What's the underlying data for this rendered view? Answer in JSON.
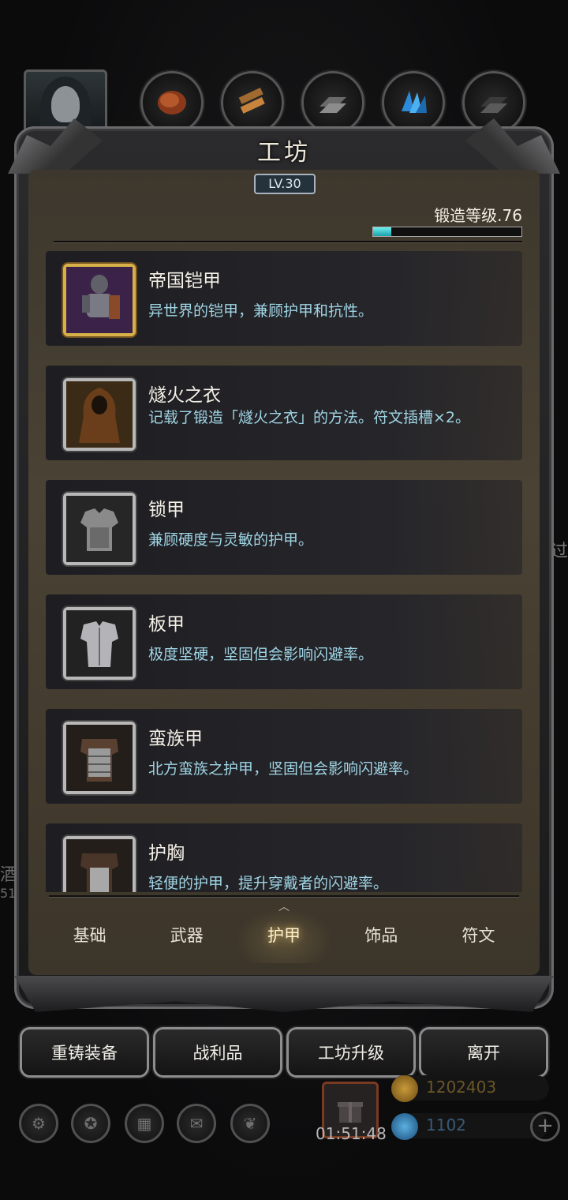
{
  "screen": {
    "title": "工坊",
    "level_badge": "LV.30",
    "forge_level_label": "锻造等级.76",
    "forge_progress": 0.12
  },
  "category_tabs": [
    {
      "icon": "leather-icon"
    },
    {
      "icon": "wood-planks-icon"
    },
    {
      "icon": "iron-ingot-icon"
    },
    {
      "icon": "blue-crystal-icon"
    },
    {
      "icon": "dark-ingot-icon"
    }
  ],
  "items": [
    {
      "name": "帝国铠甲",
      "desc": "异世界的铠甲，兼顾护甲和抗性。",
      "icon": "imperial-armor-icon",
      "rarity": "gold"
    },
    {
      "name": "燧火之衣",
      "desc": "记载了锻造「燧火之衣」的方法。符文插槽×2。",
      "icon": "ember-robe-icon",
      "rarity": "normal"
    },
    {
      "name": "锁甲",
      "desc": "兼顾硬度与灵敏的护甲。",
      "icon": "chain-mail-icon",
      "rarity": "normal"
    },
    {
      "name": "板甲",
      "desc": "极度坚硬，坚固但会影响闪避率。",
      "icon": "plate-armor-icon",
      "rarity": "normal"
    },
    {
      "name": "蛮族甲",
      "desc": "北方蛮族之护甲，坚固但会影响闪避率。",
      "icon": "barbarian-armor-icon",
      "rarity": "normal"
    },
    {
      "name": "护胸",
      "desc": "轻便的护甲，提升穿戴者的闪避率。",
      "icon": "breastplate-icon",
      "rarity": "normal"
    }
  ],
  "tabs": [
    "基础",
    "武器",
    "护甲",
    "饰品",
    "符文"
  ],
  "active_tab": "护甲",
  "bottom_buttons": [
    "重铸装备",
    "战利品",
    "工坊升级",
    "离开"
  ],
  "resources": {
    "gold": "1202403",
    "gems": "1102"
  },
  "timer": "01:51:48",
  "background_text": {
    "left": "酒",
    "left_sub": "51",
    "right": "过"
  }
}
